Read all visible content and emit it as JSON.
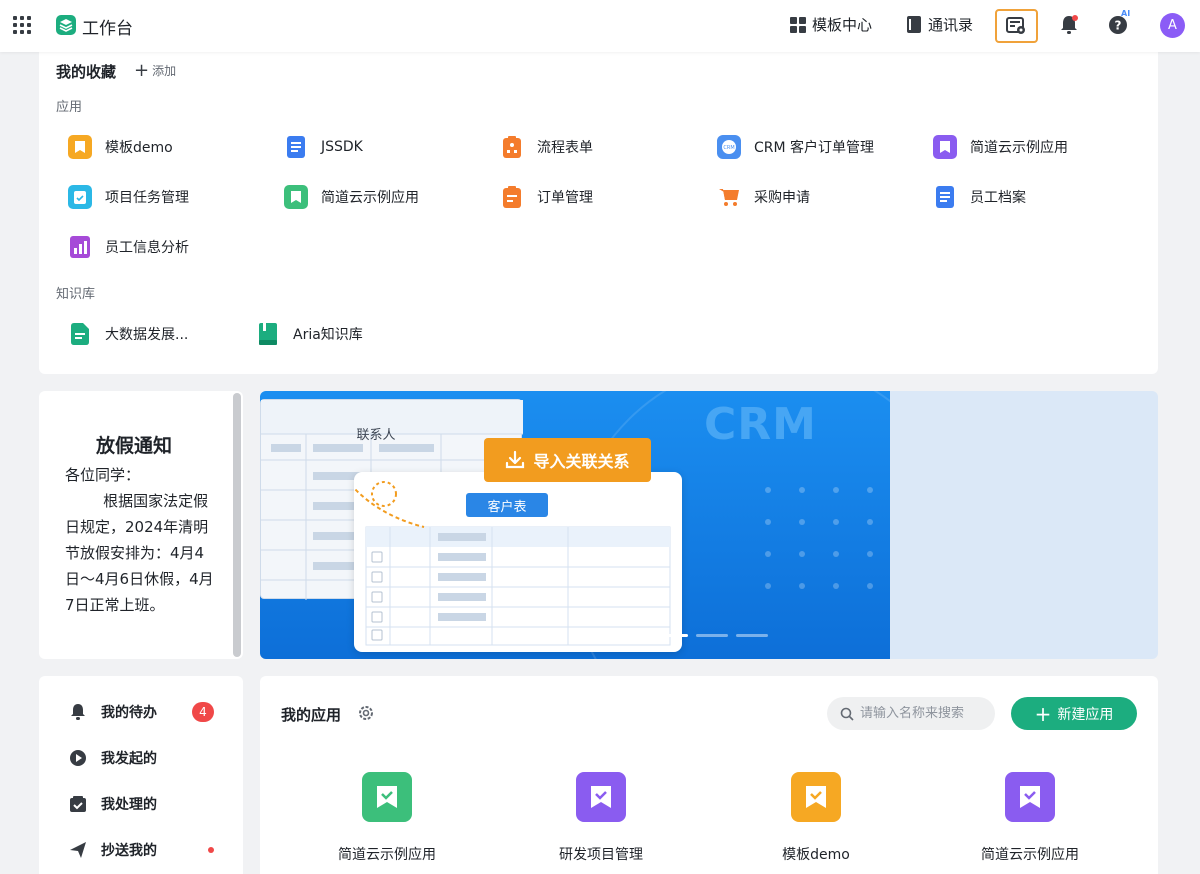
{
  "header": {
    "title": "工作台",
    "nav": [
      {
        "label": "模板中心",
        "icon": "grid-blocks-icon"
      },
      {
        "label": "通讯录",
        "icon": "contacts-book-icon"
      }
    ],
    "ai_tag": "AI",
    "avatar_initial": "A",
    "highlight_color": "#f0a23a"
  },
  "favorites": {
    "title": "我的收藏",
    "add_label": "添加",
    "apps_section": "应用",
    "apps": [
      {
        "label": "模板demo",
        "color": "#f6a823"
      },
      {
        "label": "JSSDK",
        "color": "#3b7cf0"
      },
      {
        "label": "流程表单",
        "color": "#f47c2c"
      },
      {
        "label": "CRM 客户订单管理",
        "color": "#4a8ff0"
      },
      {
        "label": "简道云示例应用",
        "color": "#8a5cf0"
      },
      {
        "label": "项目任务管理",
        "color": "#2bb8e6"
      },
      {
        "label": "简道云示例应用",
        "color": "#3cbf7b"
      },
      {
        "label": "订单管理",
        "color": "#f47c2c"
      },
      {
        "label": "采购申请",
        "color": "#f47c2c"
      },
      {
        "label": "员工档案",
        "color": "#3b7cf0"
      },
      {
        "label": "员工信息分析",
        "color": "#a64ad8"
      }
    ],
    "kb_section": "知识库",
    "kb": [
      {
        "label": "大数据发展...",
        "color": "#1cad7f"
      },
      {
        "label": "Aria知识库",
        "color": "#1cad7f"
      }
    ]
  },
  "notice": {
    "title": "放假通知",
    "body": "各位同学：\n        根据国家法定假日规定，2024年清明节放假安排为：4月4日～4月6日休假，4月7日正常上班。"
  },
  "banner": {
    "crm_text": "CRM",
    "contacts_label": "联系人",
    "import_label": "导入关联关系",
    "customer_label": "客户表",
    "slides": 3,
    "active_slide": 1
  },
  "sidebar": {
    "items": [
      {
        "label": "我的待办",
        "icon": "bell-icon"
      },
      {
        "label": "我发起的",
        "icon": "play-circle-icon"
      },
      {
        "label": "我处理的",
        "icon": "check-box-icon"
      },
      {
        "label": "抄送我的",
        "icon": "send-icon"
      }
    ],
    "todo_count": "4"
  },
  "my_apps": {
    "title": "我的应用",
    "search_placeholder": "请输入名称来搜索",
    "new_label": "新建应用",
    "apps": [
      {
        "label": "简道云示例应用",
        "color": "#3cbf7b"
      },
      {
        "label": "研发项目管理",
        "color": "#8a5cf0"
      },
      {
        "label": "模板demo",
        "color": "#f6a823"
      },
      {
        "label": "简道云示例应用",
        "color": "#8a5cf0"
      }
    ]
  }
}
